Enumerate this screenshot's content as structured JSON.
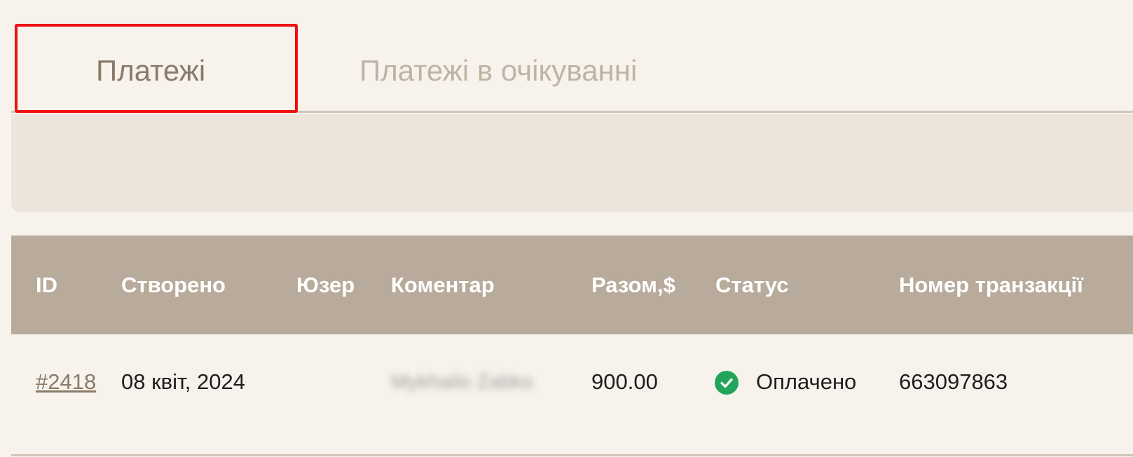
{
  "tabs": {
    "active_label": "Платежі",
    "inactive_label": "Платежі в очікуванні"
  },
  "table": {
    "headers": [
      "ID",
      "Створено",
      "Юзер",
      "Коментар",
      "Разом,$",
      "Статус",
      "Номер транзакції"
    ],
    "rows": [
      {
        "id": "#2418",
        "created": "08 квіт, 2024",
        "user": "",
        "comment": "Mykhailo Zabko",
        "total": "900.00",
        "status": "Оплачено",
        "status_icon": "check-circle-icon",
        "transaction": "663097863"
      }
    ]
  },
  "colors": {
    "highlight": "#ef1010",
    "header_bg": "#b8ab9b",
    "status_ok": "#22a55a"
  }
}
